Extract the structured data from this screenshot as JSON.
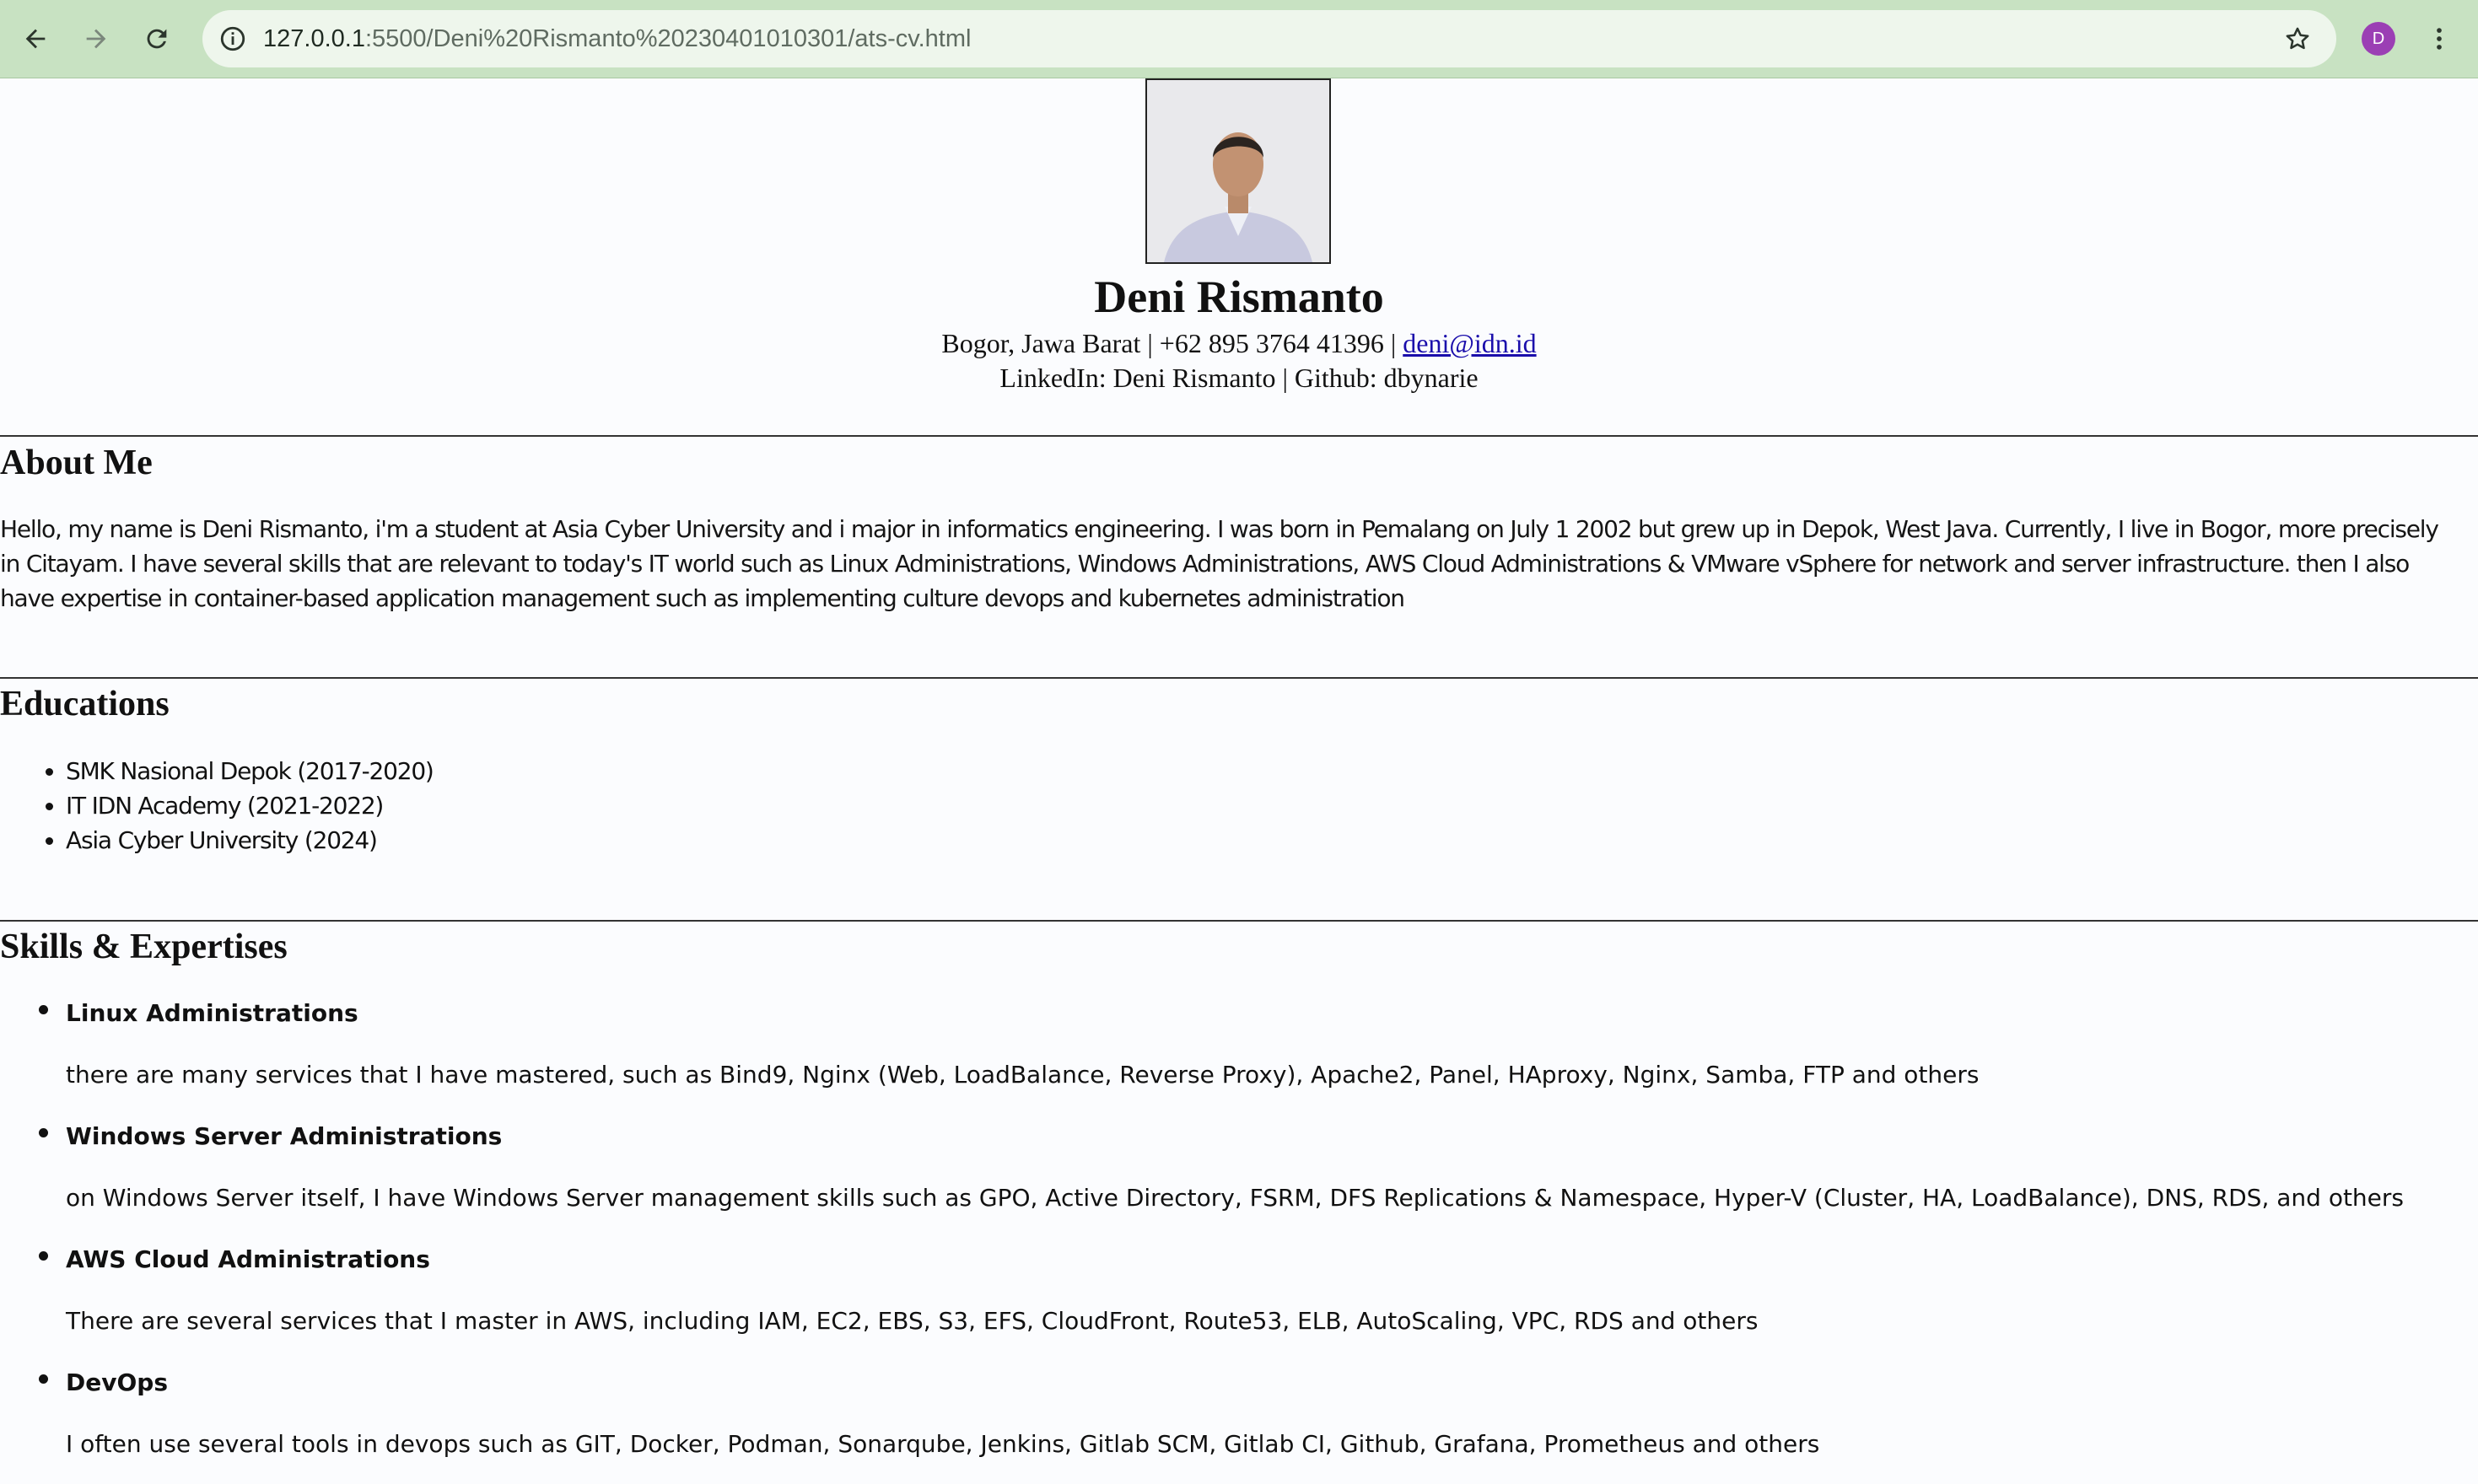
{
  "browser": {
    "url_host": "127.0.0.1",
    "url_path": ":5500/Deni%20Rismanto%20230401010301/ats-cv.html",
    "profile_initial": "D"
  },
  "header": {
    "name": "Deni Rismanto",
    "contact_line1_prefix": "Bogor, Jawa Barat |  +62 895 3764 41396 | ",
    "email": "deni@idn.id",
    "contact_line2": "LinkedIn: Deni Rismanto | Github: dbynarie"
  },
  "about": {
    "title": "About Me",
    "text": "Hello, my name is Deni Rismanto, i'm a student at Asia Cyber University and i major in informatics engineering. I was born in Pemalang on July 1 2002 but grew up in Depok, West Java. Currently, I live in Bogor, more precisely in Citayam. I have several skills that are relevant to today's IT world such as Linux Administrations, Windows Administrations, AWS Cloud Administrations & VMware vSphere for network and server infrastructure. then I also have expertise in container-based application management such as implementing culture devops and kubernetes administration"
  },
  "educations": {
    "title": "Educations",
    "items": [
      "SMK Nasional Depok (2017-2020)",
      "IT IDN Academy (2021-2022)",
      "Asia Cyber University (2024)"
    ]
  },
  "skills": {
    "title": "Skills & Expertises",
    "items": [
      {
        "name": "Linux Administrations",
        "desc": "there are many services that I have mastered, such as Bind9, Nginx (Web, LoadBalance, Reverse Proxy), Apache2, Panel, HAproxy, Nginx, Samba, FTP and others"
      },
      {
        "name": "Windows Server Administrations",
        "desc": "on Windows Server itself, I have Windows Server management skills such as GPO, Active Directory, FSRM, DFS Replications & Namespace, Hyper-V (Cluster, HA, LoadBalance), DNS, RDS, and others"
      },
      {
        "name": "AWS Cloud Administrations",
        "desc": "There are several services that I master in AWS, including IAM, EC2, EBS, S3, EFS, CloudFront, Route53, ELB, AutoScaling, VPC, RDS and others"
      },
      {
        "name": "DevOps",
        "desc": "I often use several tools in devops such as GIT, Docker, Podman, Sonarqube, Jenkins, Gitlab SCM, Gitlab CI, Github, Grafana, Prometheus and others"
      }
    ]
  }
}
